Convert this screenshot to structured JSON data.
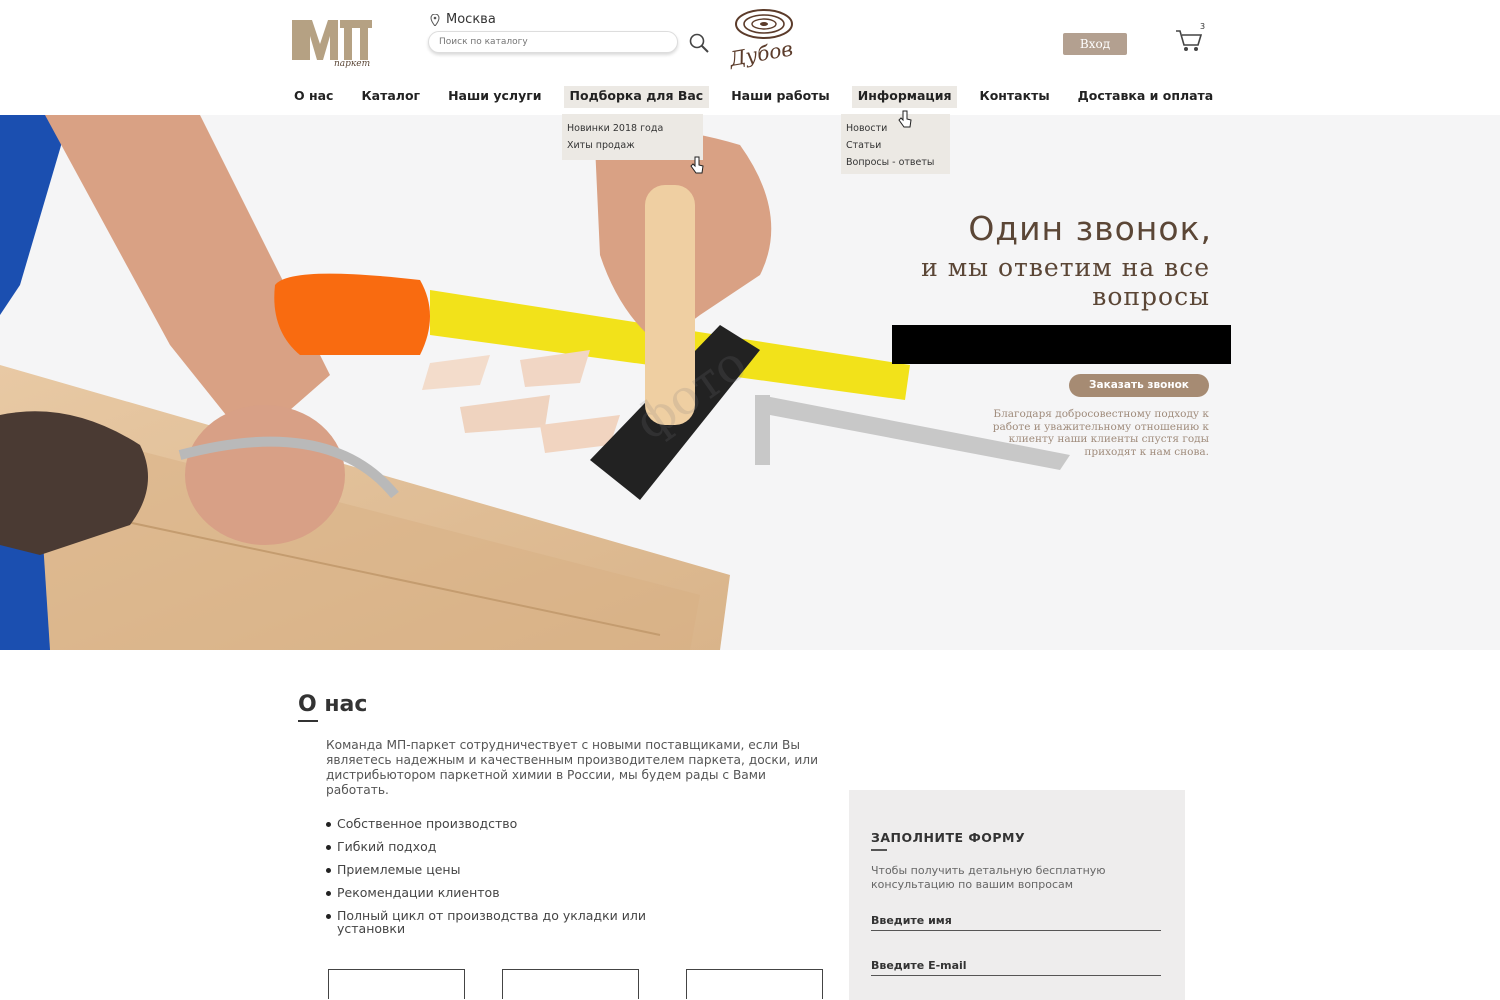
{
  "header": {
    "logo_text": "МП паркет",
    "city": "Москва",
    "search_placeholder": "Поиск по каталогу",
    "brand_name": "Дубов",
    "login_label": "Вход",
    "cart_count": "3"
  },
  "nav": {
    "items": [
      {
        "label": "О нас"
      },
      {
        "label": "Каталог"
      },
      {
        "label": "Наши услуги"
      },
      {
        "label": "Подборка для Вас"
      },
      {
        "label": "Наши работы"
      },
      {
        "label": "Информация"
      },
      {
        "label": "Контакты"
      },
      {
        "label": "Доставка и оплата"
      }
    ],
    "dropdown_selection": [
      "Новинки 2018 года",
      "Хиты продаж"
    ],
    "dropdown_info": [
      "Новости",
      "Статьи",
      "Вопросы - ответы"
    ]
  },
  "hero": {
    "title_line1": "Один звонок,",
    "title_line2": "и мы ответим на все вопросы",
    "call_button": "Заказать звонок",
    "description": "Благодаря добросовестному подходу к работе и уважительному отношению к клиенту наши клиенты спустя годы приходят к нам снова.",
    "watermark": "фото"
  },
  "about": {
    "title": "О нас",
    "text": "Команда МП-паркет сотрудничествует с новыми поставщиками, если Вы являетесь надежным и качественным производителем паркета, доски, или дистрибьютором паркетной химии в России, мы будем рады с Вами работать.",
    "bullets": [
      "Собственное производство",
      "Гибкий подход",
      "Приемлемые цены",
      "Рекомендации клиентов",
      "Полный цикл от производства до укладки или установки"
    ]
  },
  "form": {
    "title": "ЗАПОЛНИТЕ ФОРМУ",
    "subtitle": "Чтобы получить детальную бесплатную консультацию по вашим вопросам",
    "name_placeholder": "Введите имя",
    "email_placeholder": "Введите E-mail"
  },
  "colors": {
    "brand_brown": "#5b4636",
    "button_brown": "#a68b73",
    "login_button": "#b3a090",
    "dropdown_bg": "#ece9e4",
    "form_bg": "#eeeded"
  },
  "icons": [
    "location-pin-icon",
    "search-icon",
    "cart-icon",
    "cursor-pointer-icon"
  ]
}
